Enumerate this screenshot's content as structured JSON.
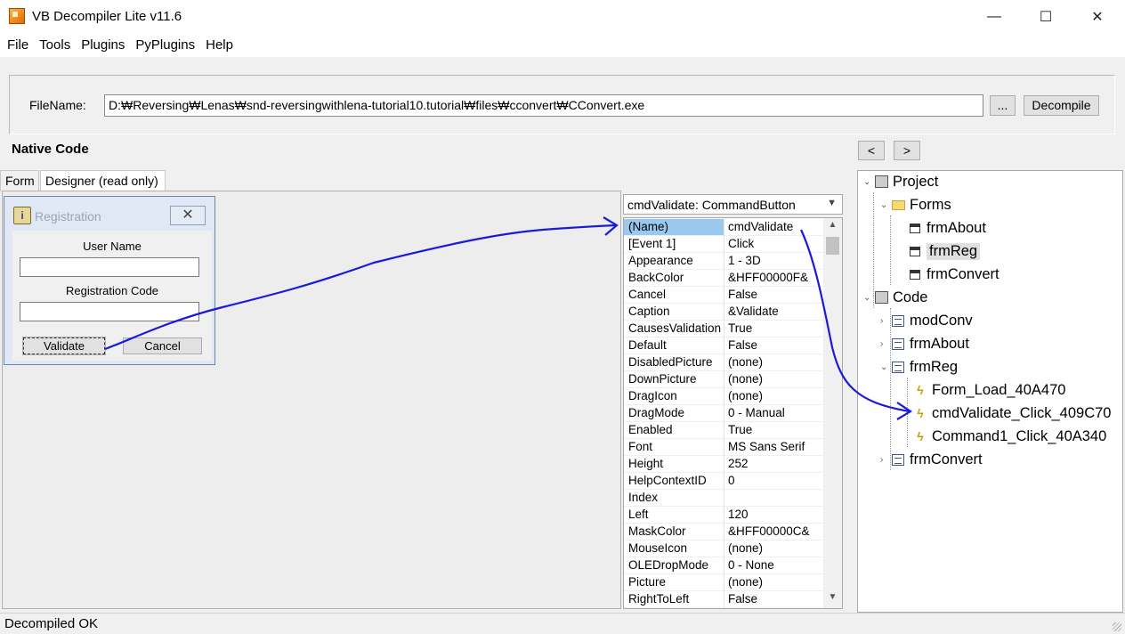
{
  "window": {
    "title": "VB Decompiler Lite v11.6",
    "minimize": "—",
    "maximize": "☐",
    "close": "✕"
  },
  "menu": [
    "File",
    "Tools",
    "Plugins",
    "PyPlugins",
    "Help"
  ],
  "file": {
    "label": "FileName:",
    "path": "D:₩Reversing₩Lenas₩snd-reversingwithlena-tutorial10.tutorial₩files₩cconvert₩CConvert.exe",
    "browse_label": "...",
    "decompile_label": "Decompile"
  },
  "section_title": "Native Code",
  "nav": {
    "prev": "<",
    "next": ">"
  },
  "tabs": [
    "Form",
    "Designer (read only)"
  ],
  "registration_form": {
    "title": "Registration",
    "username_label": "User Name",
    "regcode_label": "Registration Code",
    "validate_label": "Validate",
    "cancel_label": "Cancel"
  },
  "property_header": "cmdValidate: CommandButton",
  "properties": [
    {
      "name": "(Name)",
      "value": "cmdValidate"
    },
    {
      "name": "[Event 1]",
      "value": "Click"
    },
    {
      "name": "Appearance",
      "value": "1 - 3D"
    },
    {
      "name": "BackColor",
      "value": "&HFF00000F&"
    },
    {
      "name": "Cancel",
      "value": "False"
    },
    {
      "name": "Caption",
      "value": "&Validate"
    },
    {
      "name": "CausesValidation",
      "value": "True"
    },
    {
      "name": "Default",
      "value": "False"
    },
    {
      "name": "DisabledPicture",
      "value": "(none)"
    },
    {
      "name": "DownPicture",
      "value": "(none)"
    },
    {
      "name": "DragIcon",
      "value": "(none)"
    },
    {
      "name": "DragMode",
      "value": "0 - Manual"
    },
    {
      "name": "Enabled",
      "value": "True"
    },
    {
      "name": "Font",
      "value": "MS Sans Serif"
    },
    {
      "name": "Height",
      "value": "252"
    },
    {
      "name": "HelpContextID",
      "value": "0"
    },
    {
      "name": "Index",
      "value": ""
    },
    {
      "name": "Left",
      "value": "120"
    },
    {
      "name": "MaskColor",
      "value": "&HFF00000C&"
    },
    {
      "name": "MouseIcon",
      "value": "(none)"
    },
    {
      "name": "OLEDropMode",
      "value": "0 - None"
    },
    {
      "name": "Picture",
      "value": "(none)"
    },
    {
      "name": "RightToLeft",
      "value": "False"
    }
  ],
  "tree": {
    "project": "Project",
    "forms": "Forms",
    "form_items": [
      "frmAbout",
      "frmReg",
      "frmConvert"
    ],
    "code": "Code",
    "code_items": [
      "modConv",
      "frmAbout",
      "frmReg",
      "frmConvert"
    ],
    "frmReg_events": [
      "Form_Load_40A470",
      "cmdValidate_Click_409C70",
      "Command1_Click_40A340"
    ]
  },
  "status": "Decompiled OK",
  "colors": {
    "selection": "#99c9ef",
    "annotation": "#1a1adb"
  }
}
